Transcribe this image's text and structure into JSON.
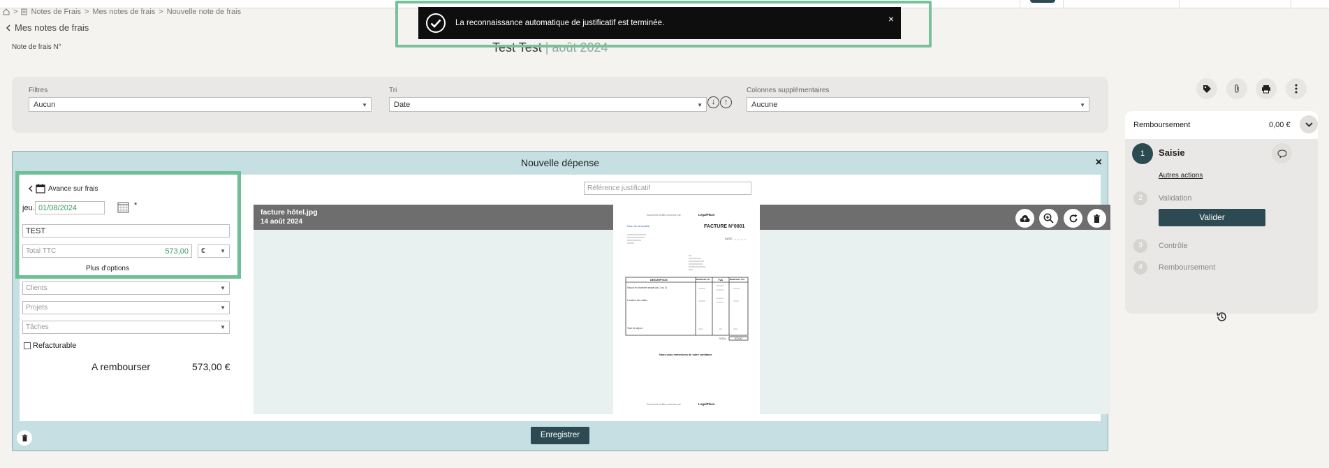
{
  "breadcrumb": {
    "parts": [
      "Notes de Frais",
      ">",
      "Mes notes de frais",
      ">",
      "Nouvelle note de frais"
    ],
    "sep": ">"
  },
  "back_link": "Mes notes de frais",
  "note_number_label": "Note de frais N°",
  "title": {
    "main": "Test Test",
    "sep": "|",
    "period": "août 2024"
  },
  "toast": {
    "message": "La reconnaissance automatique de justificatif est terminée.",
    "close": "×"
  },
  "filters": {
    "filtres_label": "Filtres",
    "filtres_value": "Aucun",
    "tri_label": "Tri",
    "tri_value": "Date",
    "colonnes_label": "Colonnes supplémentaires",
    "colonnes_value": "Aucune"
  },
  "status": {
    "header_label": "Remboursement",
    "header_amount": "0,00 €",
    "steps": [
      {
        "num": "1",
        "label": "Saisie"
      },
      {
        "num": "2",
        "label": "Validation"
      },
      {
        "num": "3",
        "label": "Contrôle"
      },
      {
        "num": "4",
        "label": "Remboursement"
      }
    ],
    "autres_actions": "Autres actions",
    "valider": "Valider"
  },
  "dialog": {
    "title": "Nouvelle dépense",
    "close": "×",
    "category": "Avance sur frais",
    "day": "jeu.",
    "date": "01/08/2024",
    "required": "*",
    "description": "TEST",
    "total_placeholder": "Total TTC",
    "total_value": "573,00",
    "currency": "€",
    "more_options": "Plus d'options",
    "clients": "Clients",
    "projets": "Projets",
    "taches": "Tâches",
    "refacturable": "Refacturable",
    "a_rembourser_label": "A rembourser",
    "a_rembourser_amount": "573,00 €",
    "reference_placeholder": "Référence justificatif",
    "file_name": "facture hôtel.jpg",
    "file_date": "14 août 2024",
    "save": "Enregistrer"
  },
  "invoice": {
    "header": "Document certifié conforme par",
    "brand": "LegalPlace",
    "title": "FACTURE N°0001",
    "seller": "Nom de la société",
    "date_label": "DATE",
    "col_description": "DESCRIPTION",
    "col_montant_ht": "MONTANT HT",
    "col_tva": "TVA",
    "col_montant_ttc": "MONTANT TTC",
    "row1": "Séjour en chambre simple (du 1 au 3)",
    "row2": "Location des salles",
    "row3": "Taxe de séjour",
    "total_label": "TOTAL",
    "total_value": "573,00",
    "thanks": "Nous vous remercions de votre confiance"
  },
  "icons": {
    "toast": "check-icon",
    "tag": "tag-icon",
    "attach": "paperclip-icon",
    "print": "printer-icon",
    "more": "kebab-icon",
    "upload": "cloud-upload-icon",
    "zoom": "zoom-in-icon",
    "rotate": "rotate-icon",
    "delete": "trash-icon"
  },
  "colors": {
    "accent": "#2d4a52",
    "highlight": "#79c19a",
    "dialog_bg": "#c5dfe2",
    "amount_green": "#3d9a5f"
  }
}
